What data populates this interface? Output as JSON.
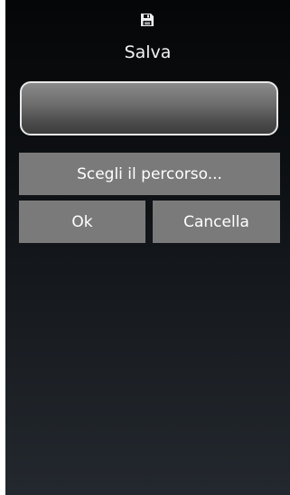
{
  "dialog": {
    "icon": "floppy-disk-icon",
    "title": "Salva",
    "filename_value": "",
    "buttons": {
      "choose_path": "Scegli il percorso...",
      "ok": "Ok",
      "cancel": "Cancella"
    }
  }
}
